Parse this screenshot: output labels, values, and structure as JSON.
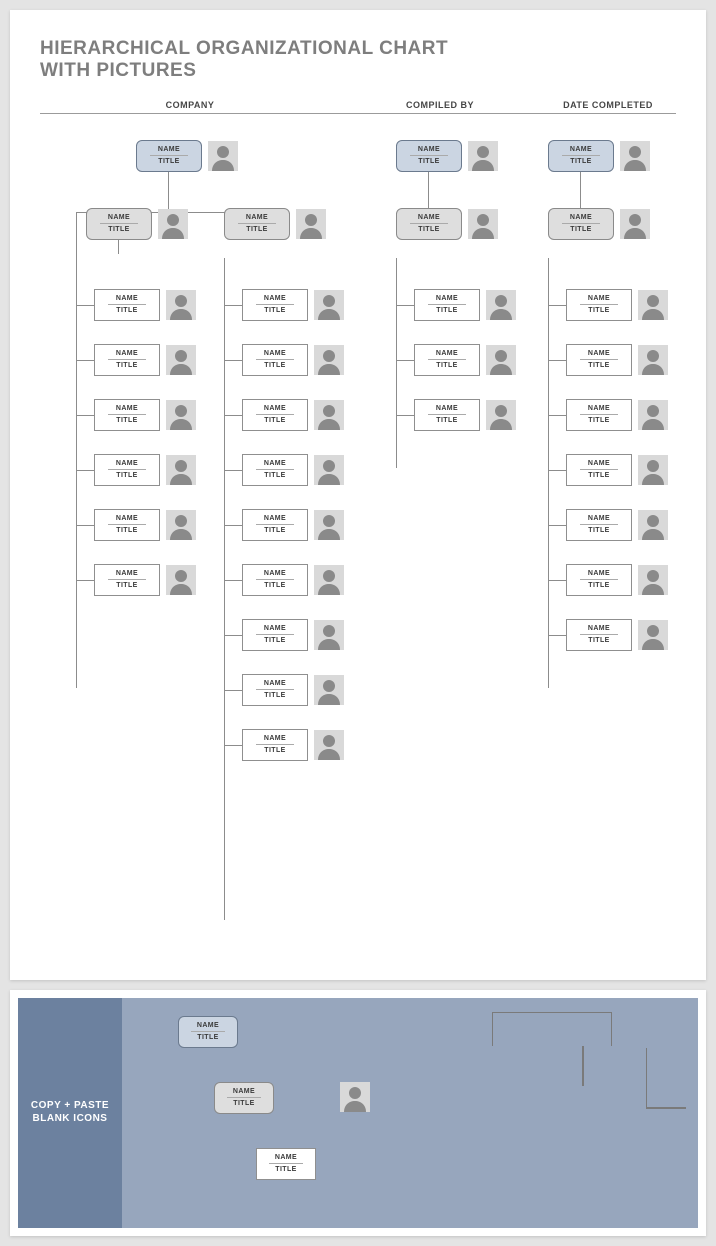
{
  "title_line1": "HIERARCHICAL ORGANIZATIONAL CHART",
  "title_line2": "WITH PICTURES",
  "headers": {
    "company": "COMPANY",
    "compiled": "COMPILED BY",
    "date": "DATE COMPLETED"
  },
  "labels": {
    "name": "NAME",
    "title": "TITLE"
  },
  "panel2_label": "COPY + PASTE BLANK ICONS",
  "chart_data": {
    "type": "table",
    "description": "Hierarchical org-chart template. Every box is an unfilled NAME / TITLE placeholder with an adjacent photo placeholder. Trees are defined by subordinate counts.",
    "trees": [
      {
        "root": {
          "name": "NAME",
          "title": "TITLE",
          "style": "root"
        },
        "subs": [
          {
            "name": "NAME",
            "title": "TITLE",
            "style": "sub",
            "reports": 6
          },
          {
            "name": "NAME",
            "title": "TITLE",
            "style": "sub",
            "reports": 9
          }
        ]
      },
      {
        "root": {
          "name": "NAME",
          "title": "TITLE",
          "style": "root"
        },
        "subs": [
          {
            "name": "NAME",
            "title": "TITLE",
            "style": "sub",
            "reports": 3
          }
        ]
      },
      {
        "root": {
          "name": "NAME",
          "title": "TITLE",
          "style": "root"
        },
        "subs": [
          {
            "name": "NAME",
            "title": "TITLE",
            "style": "sub",
            "reports": 7
          }
        ]
      }
    ],
    "blank_icons": {
      "root_card": {
        "name": "NAME",
        "title": "TITLE"
      },
      "sub_card": {
        "name": "NAME",
        "title": "TITLE"
      },
      "leaf_card": {
        "name": "NAME",
        "title": "TITLE"
      },
      "photo_placeholder": true,
      "connector_samples": true
    }
  }
}
